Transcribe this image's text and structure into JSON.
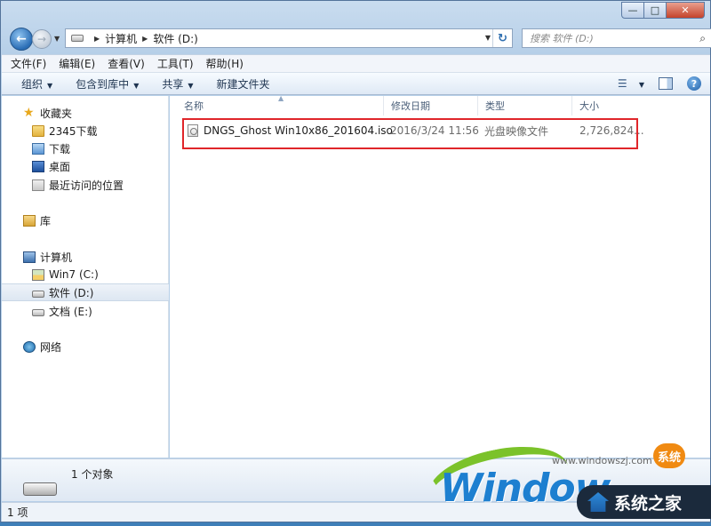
{
  "address": {
    "crumbs": [
      "计算机",
      "软件 (D:)"
    ],
    "search_placeholder": "搜索 软件 (D:)"
  },
  "menu": [
    "文件(F)",
    "编辑(E)",
    "查看(V)",
    "工具(T)",
    "帮助(H)"
  ],
  "toolbar": {
    "organize": "组织",
    "include_in_library": "包含到库中",
    "share": "共享",
    "new_folder": "新建文件夹"
  },
  "nav": {
    "favorites": "收藏夹",
    "fav_items": [
      "2345下载",
      "下载",
      "桌面",
      "最近访问的位置"
    ],
    "libraries": "库",
    "computer": "计算机",
    "drives": [
      "Win7 (C:)",
      "软件 (D:)",
      "文档 (E:)"
    ],
    "network": "网络"
  },
  "columns": {
    "name": "名称",
    "modified": "修改日期",
    "type": "类型",
    "size": "大小"
  },
  "files": [
    {
      "name": "DNGS_Ghost Win10x86_201604.iso",
      "modified": "2016/3/24 11:56",
      "type": "光盘映像文件",
      "size": "2,726,824..."
    }
  ],
  "details": {
    "count": "1 个对象"
  },
  "status": {
    "items": "1 项"
  },
  "watermark": {
    "url": "www.windowszj.com",
    "badge": "系统",
    "logo_text": "Window",
    "brand": "系统之家"
  },
  "colors": {
    "highlight": "#e0262a",
    "accent": "#1d7fd0"
  }
}
